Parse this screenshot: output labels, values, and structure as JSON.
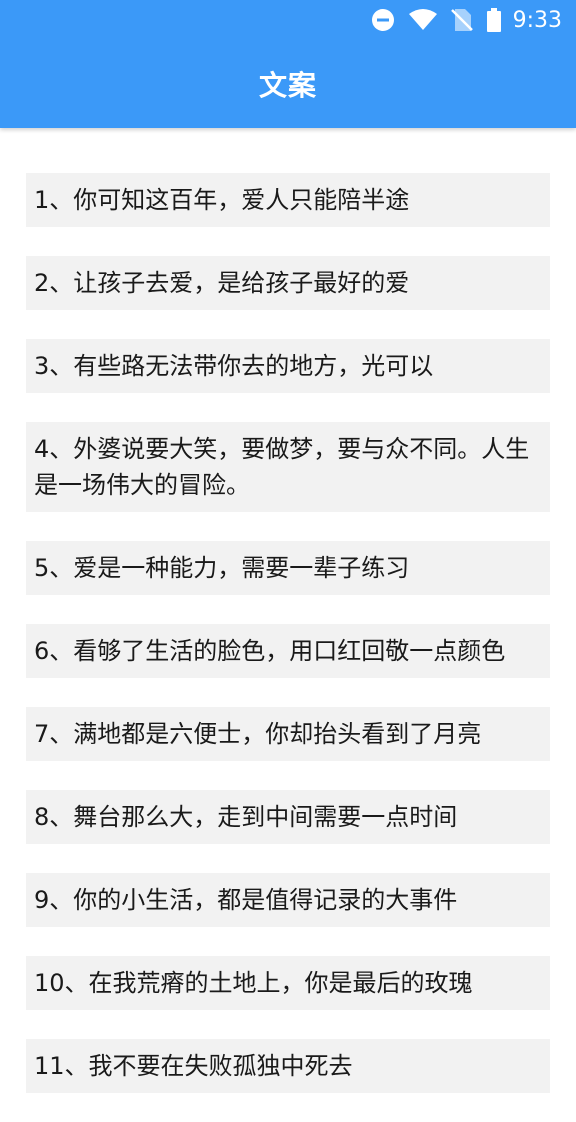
{
  "status_bar": {
    "time": "9:33",
    "icons": [
      "do-not-disturb-icon",
      "wifi-icon",
      "no-sim-icon",
      "battery-icon"
    ]
  },
  "app_bar": {
    "title": "文案",
    "color": "#3b99f8"
  },
  "items": [
    "1、你可知这百年，爱人只能陪半途",
    "2、让孩子去爱，是给孩子最好的爱",
    "3、有些路无法带你去的地方，光可以",
    "4、外婆说要大笑，要做梦，要与众不同。人生是一场伟大的冒险。",
    "5、爱是一种能力，需要一辈子练习",
    "6、看够了生活的脸色，用口红回敬一点颜色",
    "7、满地都是六便士，你却抬头看到了月亮",
    "8、舞台那么大，走到中间需要一点时间",
    "9、你的小生活，都是值得记录的大事件",
    "10、在我荒瘠的土地上，你是最后的玫瑰",
    "11、我不要在失败孤独中死去"
  ]
}
